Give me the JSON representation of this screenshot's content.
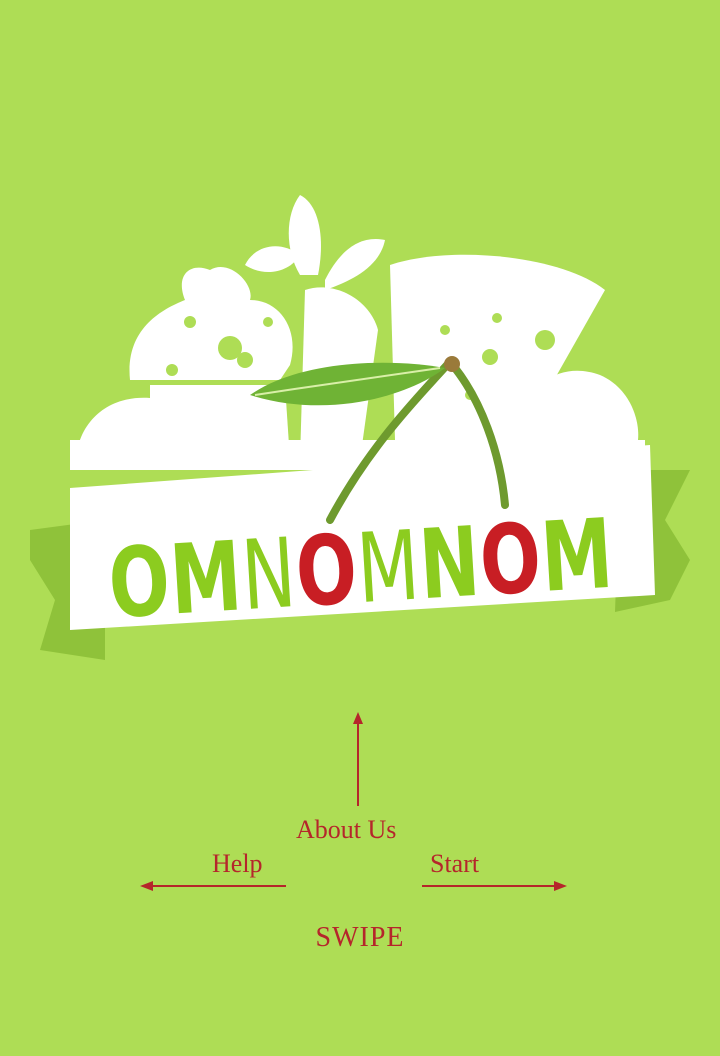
{
  "app": {
    "logo_text": "OMNOMNOM",
    "logo_parts": [
      "OM",
      "N",
      "O",
      "M",
      "N",
      "O",
      "M"
    ]
  },
  "navigation": {
    "up_label": "About Us",
    "left_label": "Help",
    "right_label": "Start",
    "hint_label": "SWIPE"
  },
  "colors": {
    "background": "#aedd55",
    "accent_red": "#b5262b",
    "logo_green": "#8ccc1f",
    "white": "#ffffff"
  },
  "icons": {
    "up": "arrow-up-icon",
    "left": "arrow-left-icon",
    "right": "arrow-right-icon"
  }
}
